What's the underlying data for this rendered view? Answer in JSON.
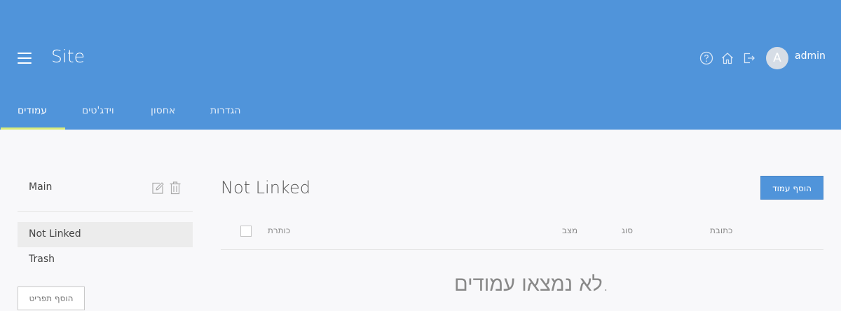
{
  "header": {
    "title": "Site",
    "username": "admin",
    "avatar_initial": "A"
  },
  "tabs": [
    {
      "label": "עמודים",
      "active": true
    },
    {
      "label": "וידג'טים",
      "active": false
    },
    {
      "label": "אחסון",
      "active": false
    },
    {
      "label": "הגדרות",
      "active": false
    }
  ],
  "sidebar": {
    "items": [
      {
        "label": "Main"
      },
      {
        "label": "Not Linked",
        "active": true
      },
      {
        "label": "Trash"
      }
    ],
    "add_item_label": "הוסף תפריט"
  },
  "main": {
    "heading": "Not Linked",
    "add_page_label": "הוסף עמוד",
    "columns": [
      "כותרת",
      "מצב",
      "סוג",
      "כתובת"
    ],
    "empty_message": "לא נמצאו עמודים."
  },
  "colors": {
    "header_bg": "#5094da",
    "tab_underline": "#d9ec7a",
    "primary_button": "#5094da"
  },
  "icons": [
    "menu-icon",
    "help-icon",
    "home-icon",
    "logout-icon",
    "edit-icon",
    "trash-icon"
  ]
}
